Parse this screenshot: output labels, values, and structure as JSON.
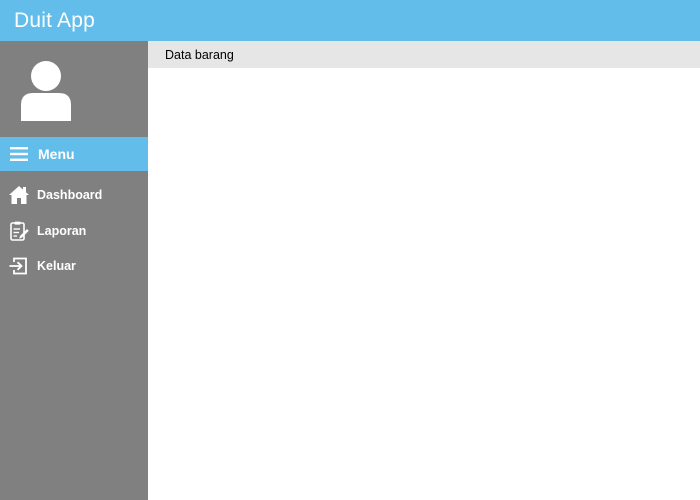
{
  "app": {
    "title": "Duit App"
  },
  "sidebar": {
    "menu_label": "Menu",
    "items": [
      {
        "label": "Dashboard",
        "icon": "home-icon"
      },
      {
        "label": "Laporan",
        "icon": "report-icon"
      },
      {
        "label": "Keluar",
        "icon": "logout-icon"
      }
    ]
  },
  "content": {
    "title": "Data barang"
  },
  "colors": {
    "accent": "#62bdea",
    "sidebar_bg": "#808080",
    "content_header_bg": "#e6e6e6",
    "content_bg": "#ffffff"
  }
}
